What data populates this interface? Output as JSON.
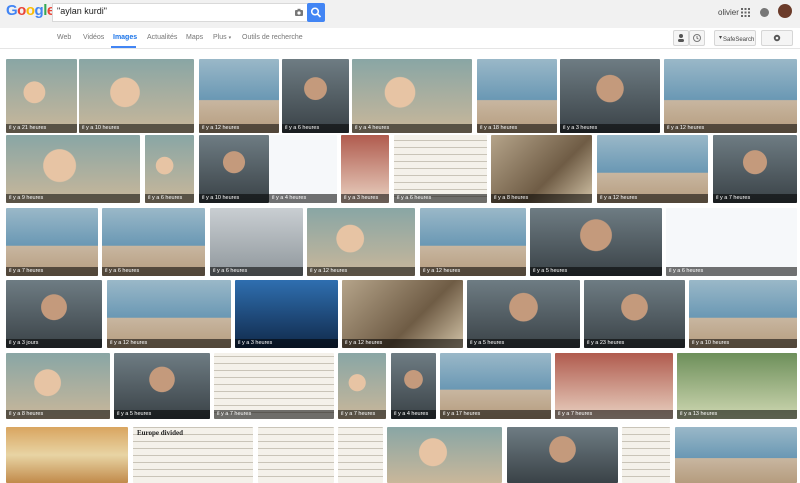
{
  "header": {
    "logo": "Google",
    "search_value": "\"aylan kurdi\"",
    "user_name": "olivier"
  },
  "nav": {
    "tabs": [
      "Web",
      "Vidéos",
      "Images",
      "Actualités",
      "Maps",
      "Plus",
      "Outils de recherche"
    ],
    "active_tab": "Images",
    "safesearch_label": "SafeSearch"
  },
  "tiles": [
    {
      "caption": "il y a 21 heures",
      "style": "child"
    },
    {
      "caption": "il y a 10 heures",
      "style": "child"
    },
    {
      "caption": "il y a 12 heures",
      "style": "sea"
    },
    {
      "caption": "il y a 6 heures",
      "style": "man"
    },
    {
      "caption": "il y a 4 heures",
      "style": "child"
    },
    {
      "caption": "il y a 18 heures",
      "style": "sea"
    },
    {
      "caption": "il y a 3 heures",
      "style": "man"
    },
    {
      "caption": "il y a 12 heures",
      "style": "sea"
    },
    {
      "caption": "il y a 9 heures",
      "style": "child"
    },
    {
      "caption": "il y a 6 heures",
      "style": "child"
    },
    {
      "caption": "il y a 10 heures",
      "style": "man"
    },
    {
      "caption": "il y a 4 heures",
      "style": "twitter"
    },
    {
      "caption": "il y a 3 heures",
      "style": "redbg"
    },
    {
      "caption": "il y a 6 heures",
      "style": "paper"
    },
    {
      "caption": "il y a 8 heures",
      "style": "crowd"
    },
    {
      "caption": "il y a 12 heures",
      "style": "sea"
    },
    {
      "caption": "il y a 7 heures",
      "style": "man"
    },
    {
      "caption": "il y a 7 heures",
      "style": "sea"
    },
    {
      "caption": "il y a 6 heures",
      "style": "sea"
    },
    {
      "caption": "il y a 6 heures",
      "style": "grey"
    },
    {
      "caption": "il y a 12 heures",
      "style": "child"
    },
    {
      "caption": "il y a 12 heures",
      "style": "sea"
    },
    {
      "caption": "il y a 5 heures",
      "style": "man"
    },
    {
      "caption": "il y a 6 heures",
      "style": "twitter"
    },
    {
      "caption": "il y a 3 jours",
      "style": "man"
    },
    {
      "caption": "il y a 12 heures",
      "style": "sea"
    },
    {
      "caption": "il y a 3 heures",
      "style": "blue"
    },
    {
      "caption": "il y a 12 heures",
      "style": "crowd"
    },
    {
      "caption": "il y a 5 heures",
      "style": "man"
    },
    {
      "caption": "il y a 23 heures",
      "style": "man"
    },
    {
      "caption": "il y a 10 heures",
      "style": "sea"
    },
    {
      "caption": "il y a 8 heures",
      "style": "child"
    },
    {
      "caption": "il y a 5 heures",
      "style": "man"
    },
    {
      "caption": "il y a 7 heures",
      "style": "paper"
    },
    {
      "caption": "il y a 7 heures",
      "style": "child"
    },
    {
      "caption": "il y a 4 heures",
      "style": "man"
    },
    {
      "caption": "il y a 17 heures",
      "style": "sea"
    },
    {
      "caption": "il y a 7 heures",
      "style": "redbg"
    },
    {
      "caption": "il y a 13 heures",
      "style": "greenbg"
    },
    {
      "caption": "",
      "style": "sunset"
    },
    {
      "caption": "Europe divided",
      "style": "paper"
    },
    {
      "caption": "",
      "style": "paper"
    },
    {
      "caption": "",
      "style": "paper"
    },
    {
      "caption": "",
      "style": "child"
    },
    {
      "caption": "",
      "style": "man"
    },
    {
      "caption": "",
      "style": "paper"
    },
    {
      "caption": "",
      "style": "sea"
    }
  ]
}
